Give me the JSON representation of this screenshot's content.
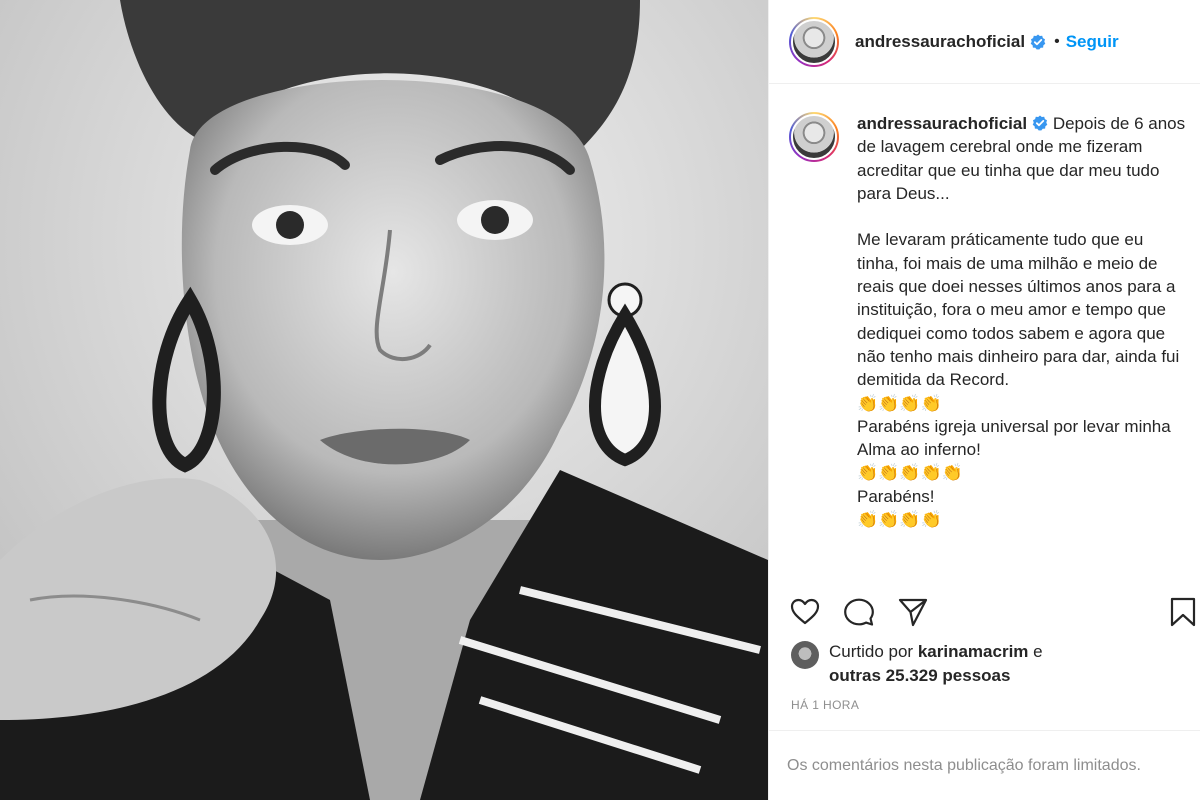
{
  "post": {
    "username": "andressaurachoficial",
    "follow_label": "Seguir",
    "separator": "•",
    "caption_lines": [
      "Depois de 6 anos de lavagem cerebral onde me fizeram acreditar que eu tinha que dar meu tudo para Deus...",
      "",
      "Me levaram práticamente tudo que eu tinha, foi mais de uma milhão e meio de reais que doei nesses últimos anos para a instituição, fora o meu amor e tempo que dediquei como todos sabem e agora que não tenho mais dinheiro para dar, ainda fui demitida da Record.",
      "👏👏👏👏",
      "Parabéns igreja universal por levar minha Alma ao inferno!",
      "👏👏👏👏👏",
      "Parabéns!",
      "👏👏👏👏"
    ],
    "likes": {
      "prefix": "Curtido por",
      "user": "karinamacrim",
      "middle": "e",
      "others": "outras 25.329 pessoas"
    },
    "time_ago": "HÁ 1 HORA",
    "comments_notice": "Os comentários nesta publicação foram limitados."
  },
  "icons": {
    "verified": "verified-badge-icon",
    "like": "heart-icon",
    "comment": "comment-bubble-icon",
    "share": "paper-plane-icon",
    "save": "bookmark-icon"
  },
  "colors": {
    "accent": "#0095f6",
    "verified": "#3897f0",
    "text": "#262626",
    "muted": "#8e8e8e",
    "divider": "#efefef"
  }
}
